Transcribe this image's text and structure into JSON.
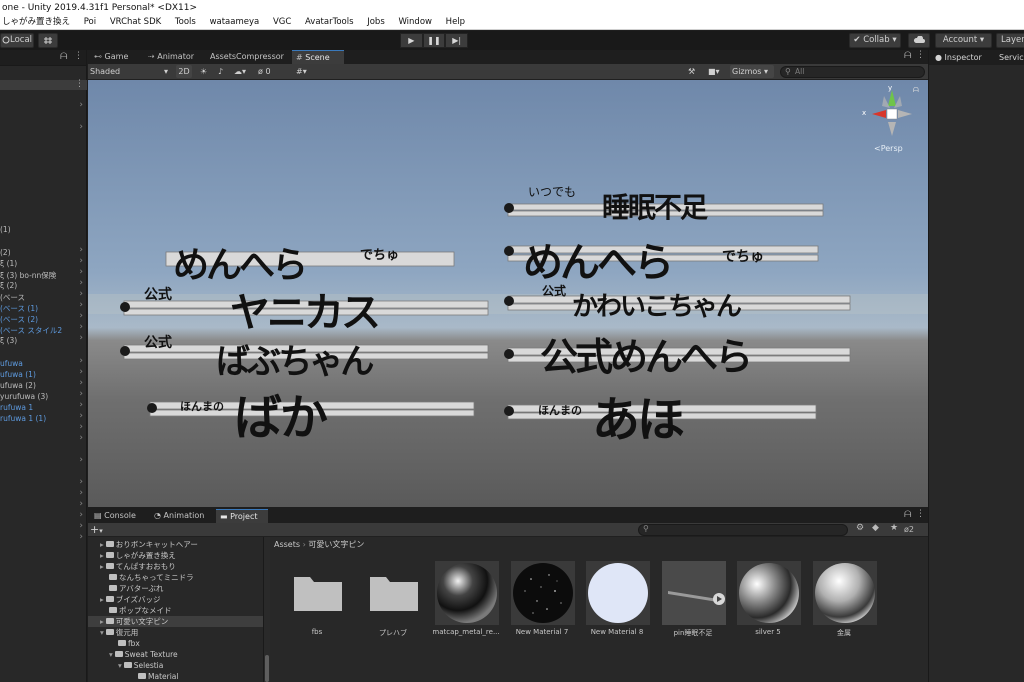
{
  "window": {
    "title": "one - Unity 2019.4.31f1 Personal* <DX11>"
  },
  "menu": [
    "しゃがみ置き換え",
    "Poi",
    "VRChat SDK",
    "Tools",
    "wataameya",
    "VGC",
    "AvatarTools",
    "Jobs",
    "Window",
    "Help"
  ],
  "toolbar": {
    "local_label": "Local",
    "collab_label": "Collab",
    "account_label": "Account",
    "layers_label": "Layer",
    "play_icons": [
      "▶",
      "❚❚",
      "▶|"
    ]
  },
  "hierarchy": {
    "rows": [
      {
        "text": "(1)",
        "style": "grey"
      },
      {
        "text": "(2)",
        "style": "grey"
      },
      {
        "text": "ξ (1)",
        "style": "grey"
      },
      {
        "text": "ξ (3) bo-nn保険",
        "style": "grey"
      },
      {
        "text": "ξ (2)",
        "style": "grey"
      },
      {
        "text": "(ベース",
        "style": "grey"
      },
      {
        "text": "(ベース (1)",
        "style": "blue"
      },
      {
        "text": "(ベース (2)",
        "style": "blue"
      },
      {
        "text": "(ベース スタイル2",
        "style": "blue"
      },
      {
        "text": "ξ (3)",
        "style": "grey"
      },
      {
        "text": "ufuwa",
        "style": "blue"
      },
      {
        "text": "ufuwa (1)",
        "style": "blue"
      },
      {
        "text": "ufuwa (2)",
        "style": "grey"
      },
      {
        "text": "yurufuwa (3)",
        "style": "grey"
      },
      {
        "text": "rufuwa 1",
        "style": "blue"
      },
      {
        "text": "rufuwa 1 (1)",
        "style": "blue"
      }
    ]
  },
  "scene": {
    "tabs": [
      "Game",
      "Animator",
      "AssetsCompressor",
      "Scene"
    ],
    "active_tab": "Scene",
    "shading_mode": "Shaded",
    "mode_2d": "2D",
    "hidden_count": "0",
    "gizmos_label": "Gizmos",
    "search_placeholder": "All",
    "persp_label": "Persp",
    "gizmo_axes": [
      "y",
      "x"
    ],
    "signs": [
      {
        "small": "いつでも",
        "big": "睡眠不足"
      },
      {
        "small": "でちゅ",
        "big": "めんへら"
      },
      {
        "small": "でちゅ",
        "big": "めんへら"
      },
      {
        "small": "公式",
        "big": "ヤニカス"
      },
      {
        "small": "公式",
        "big": "かわいこちゃん"
      },
      {
        "small": "公式",
        "big": "ばぶちゃん"
      },
      {
        "small": "",
        "big": "公式めんへら"
      },
      {
        "small": "ほんまの",
        "big": "ばか"
      },
      {
        "small": "ほんまの",
        "big": "あほ"
      }
    ]
  },
  "inspector": {
    "tabs": [
      "Inspector",
      "Servic"
    ]
  },
  "bottom": {
    "tabs": [
      "Console",
      "Animation",
      "Project"
    ],
    "active_tab": "Project",
    "count_badge": "2",
    "breadcrumb": [
      "Assets",
      "可愛い文字ピン"
    ],
    "tree": [
      {
        "label": "おりボンキャットヘアー",
        "indent": 0,
        "arrow": true
      },
      {
        "label": "しゃがみ置き換え",
        "indent": 0,
        "arrow": true
      },
      {
        "label": "てんぱすおおもり",
        "indent": 0,
        "arrow": true
      },
      {
        "label": "なんちゃってミニドラ",
        "indent": 0,
        "arrow": false
      },
      {
        "label": "アバターぶれ",
        "indent": 0,
        "arrow": false
      },
      {
        "label": "ブイズバッジ",
        "indent": 0,
        "arrow": true
      },
      {
        "label": "ポップなメイド",
        "indent": 0,
        "arrow": false
      },
      {
        "label": "可愛い文字ピン",
        "indent": 0,
        "arrow": true,
        "selected": true
      },
      {
        "label": "復元用",
        "indent": 0,
        "arrow": true,
        "open": true
      },
      {
        "label": "fbx",
        "indent": 1,
        "arrow": false
      },
      {
        "label": "Sweat Texture",
        "indent": 1,
        "arrow": true,
        "open": true
      },
      {
        "label": "Selestia",
        "indent": 2,
        "arrow": true,
        "open": true
      },
      {
        "label": "Material",
        "indent": 3,
        "arrow": false
      }
    ],
    "assets": [
      {
        "name": "fbs",
        "kind": "folder"
      },
      {
        "name": "プレハブ",
        "kind": "folder"
      },
      {
        "name": "matcap_metal_re...",
        "kind": "sphere-metal"
      },
      {
        "name": "New Material 7",
        "kind": "sphere-sparkle"
      },
      {
        "name": "New Material 8",
        "kind": "sphere-pale"
      },
      {
        "name": "pin睡眠不足",
        "kind": "mesh"
      },
      {
        "name": "silver 5",
        "kind": "sphere-silver"
      },
      {
        "name": "金属",
        "kind": "sphere-chrome"
      }
    ]
  }
}
